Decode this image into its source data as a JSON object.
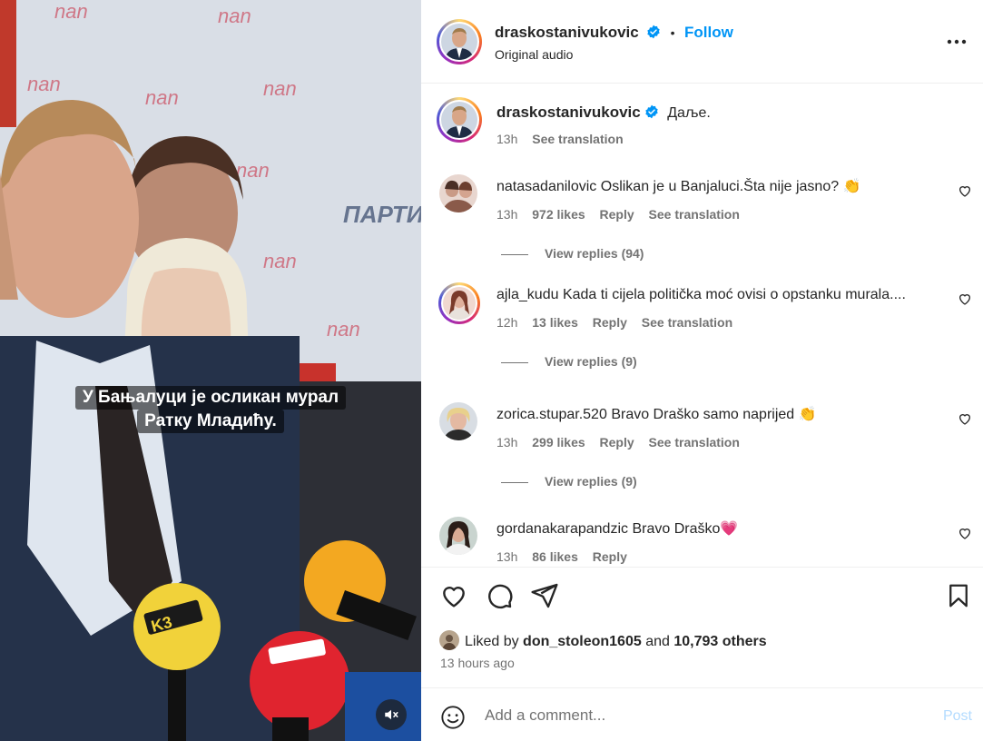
{
  "post": {
    "username": "draskostanivukovic",
    "follow_label": "Follow",
    "audio_label": "Original audio",
    "caption_text": "Даље.",
    "caption_time": "13h",
    "see_translation": "See translation"
  },
  "video": {
    "subtitle_line1": "У Бањалуци је осликан мурал",
    "subtitle_line2": "Ратку Младићу.",
    "muted": true
  },
  "comments": [
    {
      "username": "natasadanilovic",
      "text": "Oslikan je u Banjaluci.Šta nije jasno? 👏",
      "time": "13h",
      "likes": "972 likes",
      "reply": "Reply",
      "translate": "See translation",
      "view_replies": "View replies (94)"
    },
    {
      "username": "ajla_kudu",
      "text": "Kada ti cijela politička moć ovisi o opstanku murala....",
      "time": "12h",
      "likes": "13 likes",
      "reply": "Reply",
      "translate": "See translation",
      "view_replies": "View replies (9)"
    },
    {
      "username": "zorica.stupar.520",
      "text": "Bravo Draško samo naprijed 👏",
      "time": "13h",
      "likes": "299 likes",
      "reply": "Reply",
      "translate": "See translation",
      "view_replies": "View replies (9)"
    },
    {
      "username": "gordanakarapandzic",
      "text": "Bravo Draško💗",
      "time": "13h",
      "likes": "86 likes",
      "reply": "Reply"
    }
  ],
  "liked": {
    "prefix": "Liked by",
    "user": "don_stoleon1605",
    "and": "and",
    "others": "10,793 others"
  },
  "posted_ago": "13 hours ago",
  "add_comment": {
    "placeholder": "Add a comment...",
    "post_label": "Post"
  },
  "colors": {
    "accent": "#0095f6",
    "text": "#262626",
    "muted": "#737373",
    "post_disabled": "#b3dbff"
  }
}
